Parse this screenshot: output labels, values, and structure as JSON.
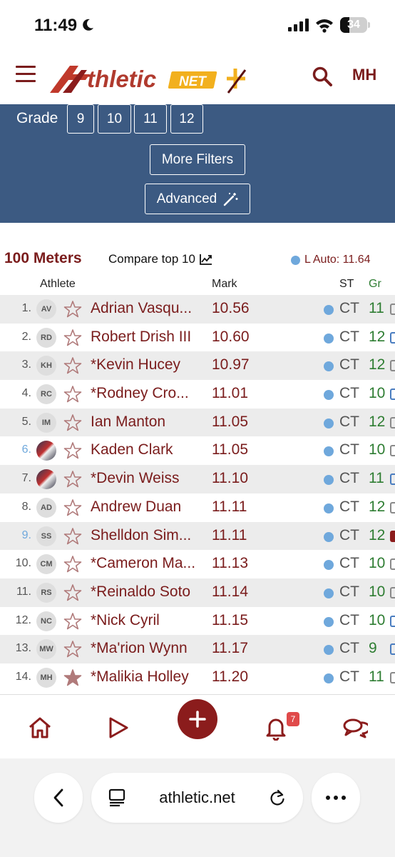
{
  "status_bar": {
    "time": "11:49",
    "battery": "34",
    "battery_level": 0.34
  },
  "header": {
    "logo_text": "AthleticNET",
    "user_initials": "MH"
  },
  "filters": {
    "grade_label": "Grade",
    "grades": [
      "9",
      "10",
      "11",
      "12"
    ],
    "more_filters_label": "More Filters",
    "advanced_label": "Advanced"
  },
  "results": {
    "event_title": "100 Meters",
    "compare_label": "Compare top 10",
    "legend_text": "L Auto: 11.64",
    "columns": {
      "athlete": "Athlete",
      "mark": "Mark",
      "state": "ST",
      "grade": "Gr"
    },
    "rows": [
      {
        "rank": "1.",
        "initials": "AV",
        "name": "Adrian Vasqu...",
        "mark": "10.56",
        "state": "CT",
        "grade": "11",
        "favorite": false
      },
      {
        "rank": "2.",
        "initials": "RD",
        "name": "Robert Drish III",
        "mark": "10.60",
        "state": "CT",
        "grade": "12",
        "favorite": false
      },
      {
        "rank": "3.",
        "initials": "KH",
        "name": "*Kevin Hucey",
        "mark": "10.97",
        "state": "CT",
        "grade": "12",
        "favorite": false
      },
      {
        "rank": "4.",
        "initials": "RC",
        "name": "*Rodney Cro...",
        "mark": "11.01",
        "state": "CT",
        "grade": "10",
        "favorite": false
      },
      {
        "rank": "5.",
        "initials": "IM",
        "name": "Ian Manton",
        "mark": "11.05",
        "state": "CT",
        "grade": "12",
        "favorite": false
      },
      {
        "rank": "6.",
        "initials": "",
        "name": "Kaden Clark",
        "mark": "11.05",
        "state": "CT",
        "grade": "10",
        "favorite": false
      },
      {
        "rank": "7.",
        "initials": "",
        "name": "*Devin Weiss",
        "mark": "11.10",
        "state": "CT",
        "grade": "11",
        "favorite": false
      },
      {
        "rank": "8.",
        "initials": "AD",
        "name": "Andrew Duan",
        "mark": "11.11",
        "state": "CT",
        "grade": "12",
        "favorite": false
      },
      {
        "rank": "9.",
        "initials": "SS",
        "name": "Shelldon Sim...",
        "mark": "11.11",
        "state": "CT",
        "grade": "12",
        "favorite": false
      },
      {
        "rank": "10.",
        "initials": "CM",
        "name": "*Cameron Ma...",
        "mark": "11.13",
        "state": "CT",
        "grade": "10",
        "favorite": false
      },
      {
        "rank": "11.",
        "initials": "RS",
        "name": "*Reinaldo Soto",
        "mark": "11.14",
        "state": "CT",
        "grade": "10",
        "favorite": false
      },
      {
        "rank": "12.",
        "initials": "NC",
        "name": "*Nick Cyril",
        "mark": "11.15",
        "state": "CT",
        "grade": "10",
        "favorite": false
      },
      {
        "rank": "13.",
        "initials": "MW",
        "name": "*Ma'rion Wynn",
        "mark": "11.17",
        "state": "CT",
        "grade": "9",
        "favorite": false
      },
      {
        "rank": "14.",
        "initials": "MH",
        "name": "*Malikia Holley",
        "mark": "11.20",
        "state": "CT",
        "grade": "11",
        "favorite": true
      }
    ]
  },
  "bottom_nav": {
    "notification_count": "7"
  },
  "browser": {
    "url": "athletic.net"
  },
  "colors": {
    "brand": "#7a1c1c",
    "panel": "#3c5a82",
    "dot": "#6fa8dc",
    "grade_green": "#2e7d32"
  }
}
